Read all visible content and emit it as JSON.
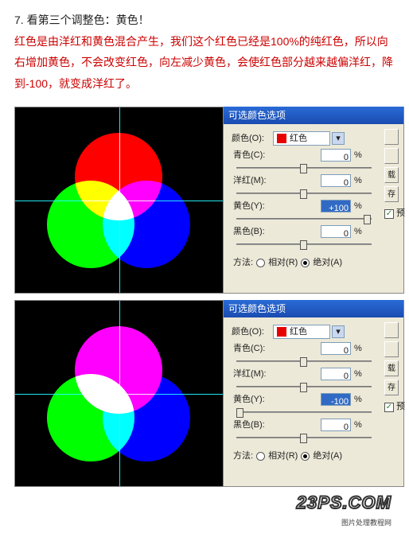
{
  "article": {
    "step_line": "7. 看第三个调整色：黄色！",
    "p1": "红色是由洋红和黄色混合产生，我们这个红色已经是100%的纯红色，所以向右增加黄色，不会改变红色，向左减少黄色，会使红色部分越来越偏洋红，降到-100，就变成洋红了。"
  },
  "panel": {
    "title": "可选颜色选项",
    "color_label": "颜色(O):",
    "color_name": "红色",
    "sliders": [
      {
        "label": "青色(C):",
        "value": "0"
      },
      {
        "label": "洋红(M):",
        "value": "0"
      },
      {
        "label": "黄色(Y):",
        "value": "+100",
        "hl": true,
        "pos_right": true
      },
      {
        "label": "黑色(B):",
        "value": "0"
      }
    ],
    "method_label": "方法:",
    "method_rel": "相对(R)",
    "method_abs": "绝对(A)",
    "side": {
      "b1": "",
      "b2": "",
      "b3": "载",
      "b4": "存",
      "chk": "预"
    }
  },
  "panel2": {
    "title": "可选颜色选项",
    "color_label": "颜色(O):",
    "color_name": "红色",
    "sliders": [
      {
        "label": "青色(C):",
        "value": "0"
      },
      {
        "label": "洋红(M):",
        "value": "0"
      },
      {
        "label": "黄色(Y):",
        "value": "-100",
        "hl": true,
        "pos_left": true
      },
      {
        "label": "黑色(B):",
        "value": "0"
      }
    ],
    "method_label": "方法:",
    "method_rel": "相对(R)",
    "method_abs": "绝对(A)",
    "side": {
      "b1": "",
      "b2": "",
      "b3": "载",
      "b4": "存",
      "chk": "预"
    }
  },
  "brand": {
    "name": "23PS.COM",
    "sub": "图片处理教程网"
  }
}
